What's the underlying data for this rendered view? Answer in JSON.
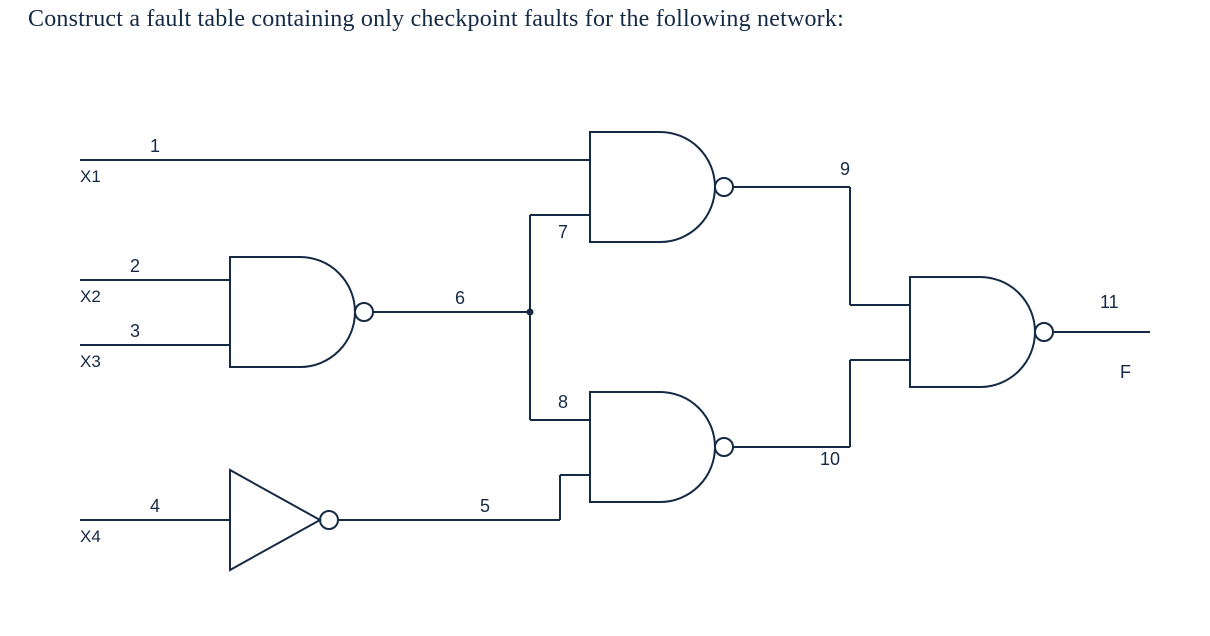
{
  "prompt_text": "Construct a fault table containing only checkpoint faults for the following network:",
  "inputs": {
    "x1": "X1",
    "x2": "X2",
    "x3": "X3",
    "x4": "X4"
  },
  "output": {
    "f": "F"
  },
  "wires": {
    "w1": "1",
    "w2": "2",
    "w3": "3",
    "w4": "4",
    "w5": "5",
    "w6": "6",
    "w7": "7",
    "w8": "8",
    "w9": "9",
    "w10": "10",
    "w11": "11"
  },
  "gates": {
    "g_nand1": {
      "type": "NAND",
      "inputs": [
        "2",
        "3"
      ],
      "output": "6"
    },
    "g_not": {
      "type": "NOT",
      "inputs": [
        "4"
      ],
      "output": "5"
    },
    "g_nand2": {
      "type": "NAND",
      "inputs": [
        "1",
        "7"
      ],
      "output": "9"
    },
    "g_nand3": {
      "type": "NAND",
      "inputs": [
        "8",
        "5"
      ],
      "output": "10"
    },
    "g_nand4": {
      "type": "NAND",
      "inputs": [
        "9",
        "10"
      ],
      "output": "11"
    }
  },
  "fanouts": {
    "from": "6",
    "to": [
      "7",
      "8"
    ]
  },
  "checkpoint_lines": [
    "1",
    "2",
    "3",
    "4",
    "7",
    "8"
  ],
  "colors": {
    "stroke": "#152a45"
  }
}
